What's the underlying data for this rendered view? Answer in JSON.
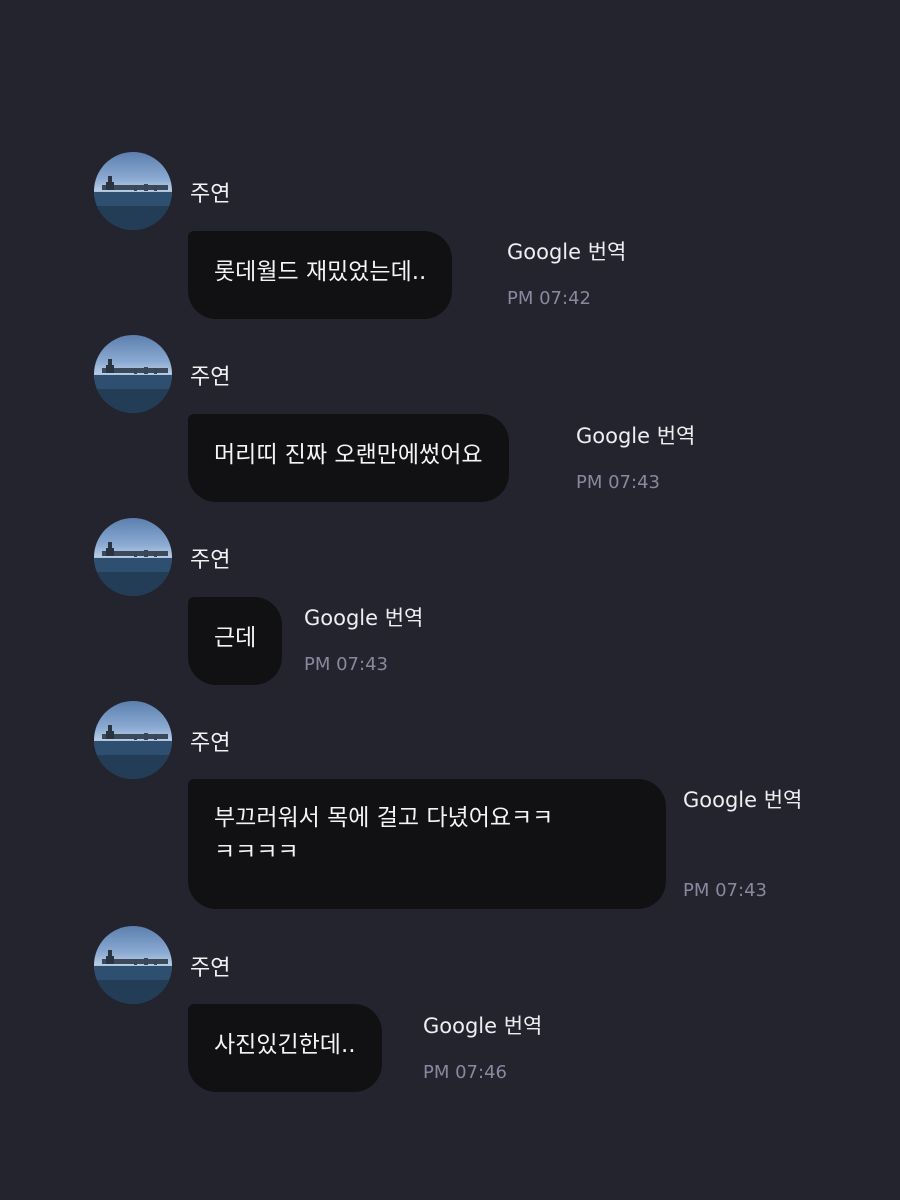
{
  "messages": [
    {
      "sender": "주연",
      "lines": [
        "롯데월드 재밌었는데.."
      ],
      "translate_label": "Google 번역",
      "time": "PM 07:42"
    },
    {
      "sender": "주연",
      "lines": [
        "머리띠 진짜 오랜만에썼어요"
      ],
      "translate_label": "Google 번역",
      "time": "PM 07:43"
    },
    {
      "sender": "주연",
      "lines": [
        "근데"
      ],
      "translate_label": "Google 번역",
      "time": "PM 07:43"
    },
    {
      "sender": "주연",
      "lines": [
        "부끄러워서 목에 걸고 다녔어요ㅋㅋ",
        "ㅋㅋㅋㅋ"
      ],
      "translate_label": "Google 번역",
      "time": "PM 07:43"
    },
    {
      "sender": "주연",
      "lines": [
        "사진있긴한데.."
      ],
      "translate_label": "Google 번역",
      "time": "PM 07:46"
    }
  ],
  "colors": {
    "background": "#24242e",
    "bubble": "#111114",
    "time_text": "#8a879e"
  }
}
